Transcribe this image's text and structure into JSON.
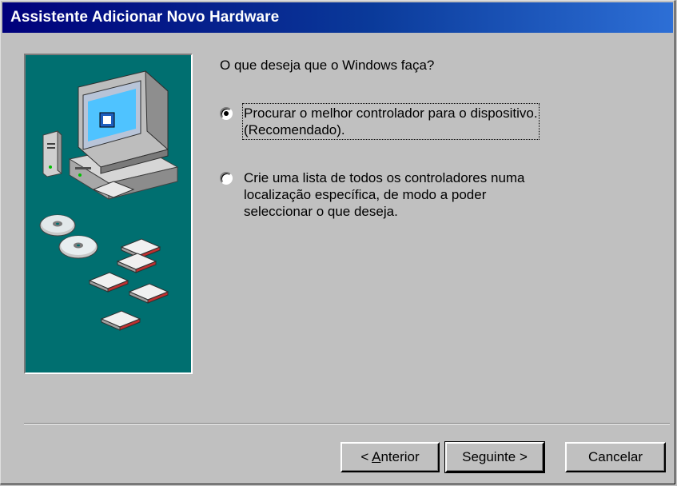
{
  "window": {
    "title": "Assistente Adicionar Novo Hardware"
  },
  "question": "O que deseja que o Windows faça?",
  "options": [
    {
      "line1": "Procurar o melhor controlador para o dispositivo.",
      "line2": "(Recomendado).",
      "checked": true
    },
    {
      "line1": "Crie uma lista de todos os controladores numa",
      "line2": "localização específica, de modo a poder",
      "line3": "seleccionar o que deseja.",
      "checked": false
    }
  ],
  "buttons": {
    "back_prefix": "< ",
    "back_mnemonic": "A",
    "back_rest": "nterior",
    "next": "Seguinte >",
    "cancel": "Cancelar"
  },
  "colors": {
    "title_gradient_start": "#00007b",
    "title_gradient_end": "#2d6fd6",
    "art_background": "#006f70",
    "dialog_face": "#c0c0c0"
  },
  "icons": [
    "computer-icon",
    "cd-icon",
    "floppy-disk-icon"
  ]
}
